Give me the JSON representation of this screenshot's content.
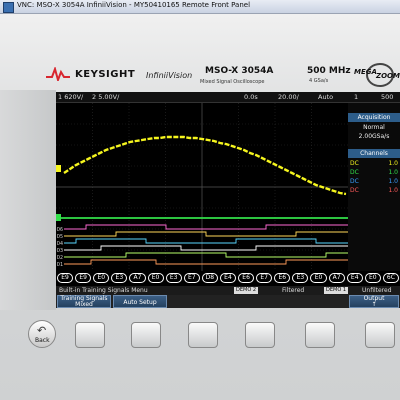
{
  "window": {
    "title": "VNC: MSO-X 3054A InfiniiVision - MY50410165 Remote Front Panel"
  },
  "brand": {
    "company": "KEYSIGHT",
    "series": "InfiniiVision",
    "model": "MSO-X 3054A",
    "model_sub": "Mixed Signal Oscilloscope",
    "bandwidth": "500 MHz",
    "sample_rate": "4 GSa/s",
    "mega_logo_text": "MEGA",
    "zoom_logo_text": "ZOOM"
  },
  "status": {
    "ch1_scale": "1  620V/",
    "ch2_scale": "2  5.00V/",
    "time_pos": "0.0s",
    "time_scale": "20.00/",
    "trigger_mode": "Auto",
    "trigger_ch": "1",
    "trigger_level": "500"
  },
  "acquisition": {
    "title": "Acquisition",
    "mode": "Normal",
    "rate": "2.00GSa/s"
  },
  "channels": {
    "title": "Channels",
    "rows": [
      {
        "label": "DC",
        "value": "1.0",
        "color": "#f5f51e"
      },
      {
        "label": "DC",
        "value": "1.0",
        "color": "#33e04a"
      },
      {
        "label": "DC",
        "value": "1.0",
        "color": "#3aa0ff"
      },
      {
        "label": "DC",
        "value": "1.0",
        "color": "#ff5a5a"
      }
    ]
  },
  "bus": {
    "values": [
      "E9",
      "E9",
      "E0",
      "E3",
      "A7",
      "E0",
      "E3",
      "E7",
      "D8",
      "E4",
      "E6",
      "E7",
      "E6",
      "E3",
      "E0",
      "A7",
      "E4",
      "E0",
      "6C"
    ]
  },
  "menu": {
    "title": "Built-in Training Signals Menu",
    "bus1_label": "DEMO 2",
    "filtered": "Filtered",
    "bus2_label": "DEMO 1",
    "unfiltered": "Unfiltered"
  },
  "softkeys": {
    "training_line1": "Training Signals",
    "training_line2": "Mixed",
    "auto_setup": "Auto Setup",
    "output_line1": "Output",
    "output_line2": "↑"
  },
  "hardware": {
    "back_label": "Back"
  }
}
